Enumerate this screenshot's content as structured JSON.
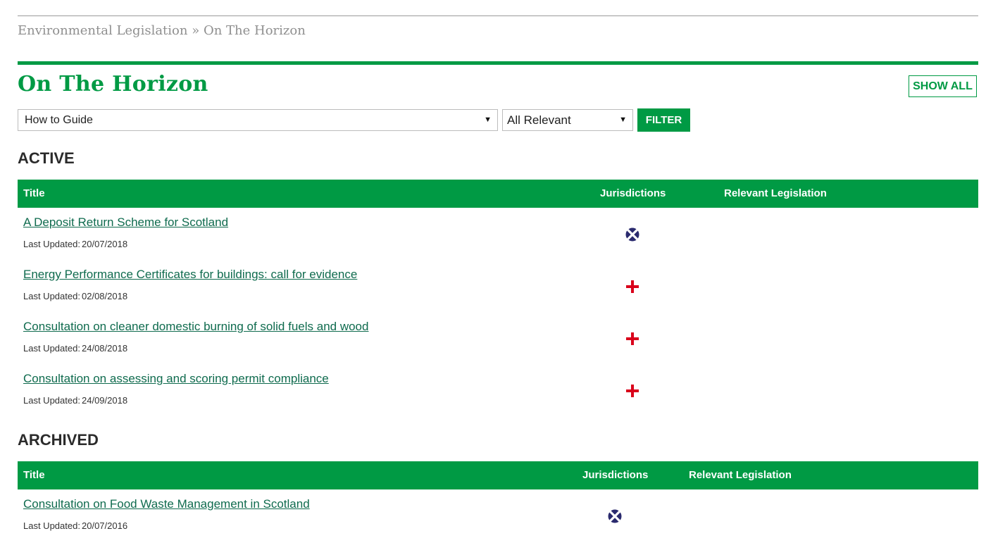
{
  "breadcrumb": {
    "root": "Environmental Legislation",
    "separator": "»",
    "current": "On The Horizon"
  },
  "page": {
    "title": "On The Horizon",
    "show_all_label": "SHOW ALL"
  },
  "filters": {
    "type_select": {
      "selected": "How to Guide"
    },
    "relevance_select": {
      "selected": "All Relevant"
    },
    "filter_label": "FILTER"
  },
  "columns": {
    "title": "Title",
    "jurisdictions": "Jurisdictions",
    "legislation": "Relevant Legislation"
  },
  "updated_label": "Last Updated:",
  "flags": {
    "scotland": {
      "icon": "scotland-flag-icon",
      "field": "#2a2a6e",
      "cross": "#ffffff"
    },
    "england": {
      "icon": "england-flag-icon",
      "cross": "#d9001b"
    }
  },
  "colors": {
    "accent": "#009a44",
    "link": "#0f6b4e"
  },
  "sections": {
    "active": {
      "heading": "ACTIVE",
      "rows": [
        {
          "title": "A Deposit Return Scheme for Scotland",
          "updated": "20/07/2018",
          "jurisdiction": "scotland"
        },
        {
          "title": "Energy Performance Certificates for buildings: call for evidence",
          "updated": "02/08/2018",
          "jurisdiction": "england"
        },
        {
          "title": "Consultation on cleaner domestic burning of solid fuels and wood",
          "updated": "24/08/2018",
          "jurisdiction": "england"
        },
        {
          "title": "Consultation on assessing and scoring permit compliance",
          "updated": "24/09/2018",
          "jurisdiction": "england"
        }
      ]
    },
    "archived": {
      "heading": "ARCHIVED",
      "rows": [
        {
          "title": "Consultation on Food Waste Management in Scotland",
          "updated": "20/07/2016",
          "jurisdiction": "scotland"
        }
      ]
    }
  }
}
